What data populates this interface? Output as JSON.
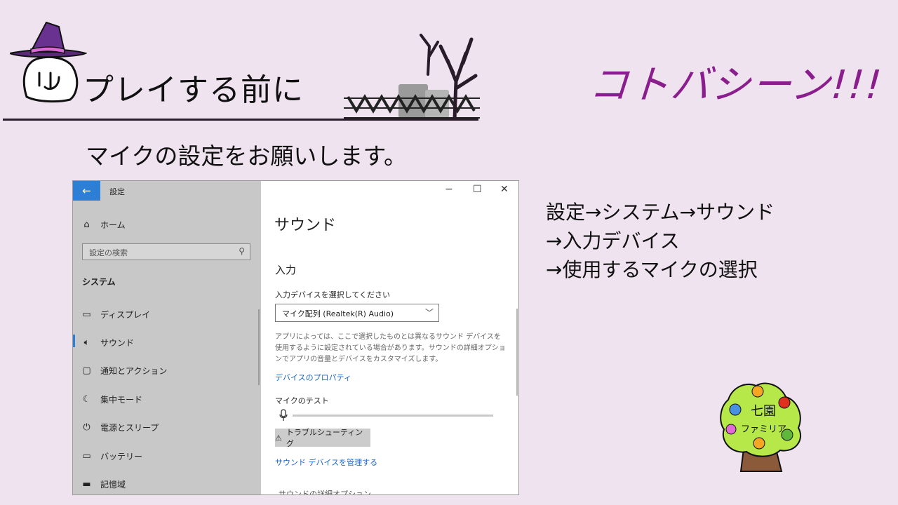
{
  "slide": {
    "title": "プレイする前に",
    "brand": "コトバシーン!!!",
    "subtitle": "マイクの設定をお願いします。",
    "steps": [
      "設定→システム→サウンド",
      "→入力デバイス",
      "→使用するマイクの選択"
    ],
    "logo_text": [
      "七園",
      "ファミリア"
    ]
  },
  "window": {
    "title": "設定",
    "controls": {
      "minimize": "−",
      "maximize": "☐",
      "close": "✕"
    },
    "sidebar": {
      "home": "ホーム",
      "search_placeholder": "設定の検索",
      "section": "システム",
      "items": [
        {
          "label": "ディスプレイ",
          "icon": "display-icon"
        },
        {
          "label": "サウンド",
          "icon": "speaker-icon"
        },
        {
          "label": "通知とアクション",
          "icon": "notification-icon"
        },
        {
          "label": "集中モード",
          "icon": "moon-icon"
        },
        {
          "label": "電源とスリープ",
          "icon": "power-icon"
        },
        {
          "label": "バッテリー",
          "icon": "battery-icon"
        },
        {
          "label": "記憶域",
          "icon": "storage-icon"
        }
      ]
    },
    "main": {
      "heading": "サウンド",
      "input_heading": "入力",
      "device_label": "入力デバイスを選択してください",
      "device_value": "マイク配列 (Realtek(R) Audio)",
      "description": "アプリによっては、ここで選択したものとは異なるサウンド デバイスを使用するように設定されている場合があります。サウンドの詳細オプションでアプリの音量とデバイスをカスタマイズします。",
      "device_properties_link": "デバイスのプロパティ",
      "mic_test_label": "マイクのテスト",
      "troubleshoot_button": "トラブルシューティング",
      "manage_link": "サウンド デバイスを管理する",
      "cut_off_heading": "サウンドの詳細オプション"
    }
  },
  "colors": {
    "accent": "#2d7fd6",
    "link": "#1a66c7",
    "brand": "#8a1e8c",
    "background": "#f0e3f0"
  }
}
